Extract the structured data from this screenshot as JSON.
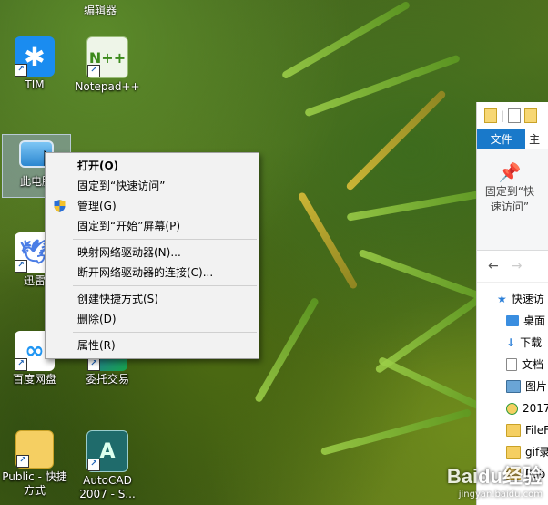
{
  "desktop": {
    "top_partial_label": "编辑器",
    "icons": [
      {
        "label": "TIM"
      },
      {
        "label": "Notepad++"
      },
      {
        "label": "此电脑"
      },
      {
        "label": "迅雷"
      },
      {
        "label": "百度网盘"
      },
      {
        "label": "委托交易"
      },
      {
        "label": "Public - 快捷方式"
      },
      {
        "label": "AutoCAD 2007 - S..."
      }
    ]
  },
  "context_menu": {
    "items": [
      {
        "label": "打开(O)"
      },
      {
        "label": "固定到“快速访问”"
      },
      {
        "label": "管理(G)"
      },
      {
        "label": "固定到“开始”屏幕(P)"
      },
      {
        "label": "映射网络驱动器(N)..."
      },
      {
        "label": "断开网络驱动器的连接(C)..."
      },
      {
        "label": "创建快捷方式(S)"
      },
      {
        "label": "删除(D)"
      },
      {
        "label": "属性(R)"
      }
    ]
  },
  "explorer": {
    "tab_file": "文件",
    "tab_home": "主",
    "pin_label": "固定到“快速访问”",
    "nav_back": "←",
    "nav_forward": "→",
    "tree": [
      {
        "label": "快速访"
      },
      {
        "label": "桌面"
      },
      {
        "label": "下载"
      },
      {
        "label": "文档"
      },
      {
        "label": "图片"
      },
      {
        "label": "2017"
      },
      {
        "label": "FileF"
      },
      {
        "label": "gif录"
      },
      {
        "label": "Pub"
      }
    ]
  },
  "watermark": {
    "brand": "Baidu经验",
    "url": "jingyan.baidu.com"
  },
  "colors": {
    "accent": "#1979ca",
    "menu_bg": "#f2f2f2"
  }
}
